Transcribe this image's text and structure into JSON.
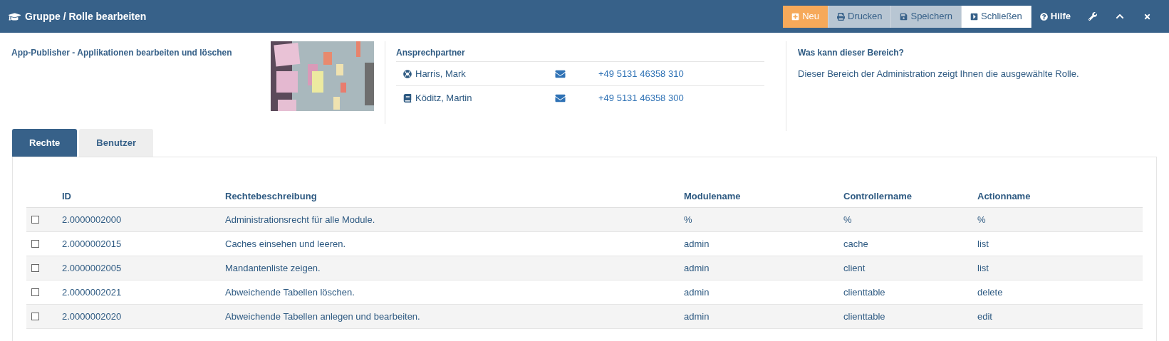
{
  "window": {
    "title": "Gruppe / Rolle bearbeiten"
  },
  "toolbar": [
    {
      "label": "Neu",
      "kind": "new"
    },
    {
      "label": "Drucken",
      "kind": "print"
    },
    {
      "label": "Speichern",
      "kind": "save"
    },
    {
      "label": "Schließen",
      "kind": "close"
    },
    {
      "label": "Hilfe",
      "kind": "help"
    }
  ],
  "description": "App-Publisher - Applikationen bearbeiten und löschen",
  "contacts": {
    "heading": "Ansprechpartner",
    "people": [
      {
        "name": "Harris, Mark",
        "kind": "support",
        "phone": "+49 5131 46358 310"
      },
      {
        "name": "Köditz, Martin",
        "kind": "docs",
        "phone": "+49 5131 46358 300"
      }
    ]
  },
  "info": {
    "heading": "Was kann dieser Bereich?",
    "text": "Dieser Bereich der Administration zeigt Ihnen die ausgewählte Rolle."
  },
  "tabs": [
    {
      "label": "Rechte",
      "selected": true
    },
    {
      "label": "Benutzer",
      "selected": false
    }
  ],
  "table": {
    "columns": [
      "ID",
      "Rechtebeschreibung",
      "Modulename",
      "Controllername",
      "Actionname"
    ],
    "rows": [
      {
        "checked": false,
        "cells": [
          "2.0000002000",
          "Administrationsrecht für alle Module.",
          "%",
          "%",
          "%"
        ]
      },
      {
        "checked": false,
        "cells": [
          "2.0000002015",
          "Caches einsehen und leeren.",
          "admin",
          "cache",
          "list"
        ]
      },
      {
        "checked": false,
        "cells": [
          "2.0000002005",
          "Mandantenliste zeigen.",
          "admin",
          "client",
          "list"
        ]
      },
      {
        "checked": false,
        "cells": [
          "2.0000002021",
          "Abweichende Tabellen löschen.",
          "admin",
          "clienttable",
          "delete"
        ]
      },
      {
        "checked": false,
        "cells": [
          "2.0000002020",
          "Abweichende Tabellen anlegen und bearbeiten.",
          "admin",
          "clienttable",
          "edit"
        ]
      }
    ]
  }
}
